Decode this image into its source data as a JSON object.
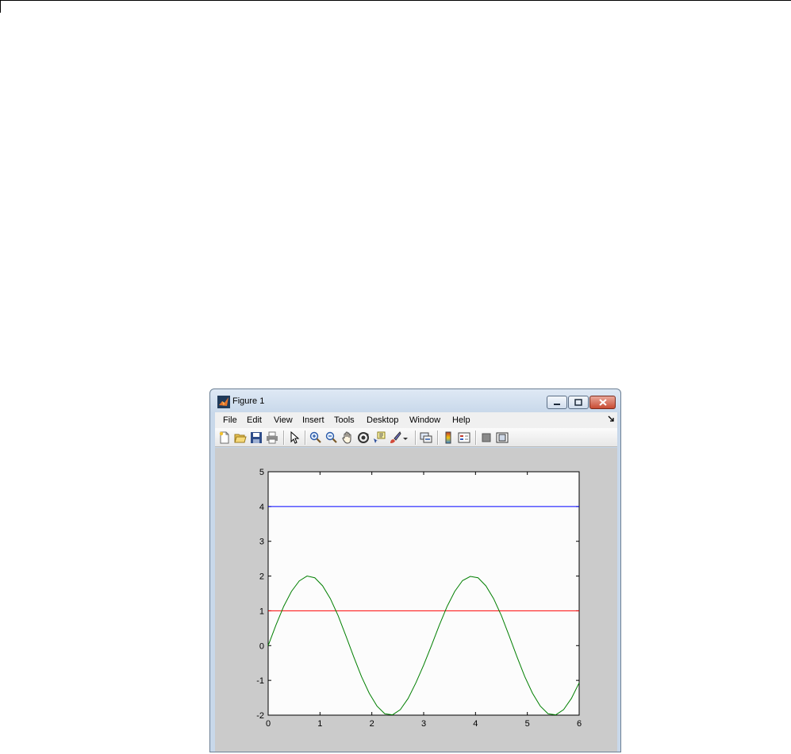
{
  "window": {
    "title": "Figure 1"
  },
  "menubar": {
    "items": [
      "File",
      "Edit",
      "View",
      "Insert",
      "Tools",
      "Desktop",
      "Window",
      "Help"
    ]
  },
  "toolbar": {
    "icons": [
      "new-figure-icon",
      "open-file-icon",
      "save-figure-icon",
      "print-figure-icon",
      "edit-plot-icon",
      "zoom-in-icon",
      "zoom-out-icon",
      "pan-icon",
      "rotate-3d-icon",
      "data-cursor-icon",
      "brush-icon",
      "brush-dropdown-icon",
      "link-plot-icon",
      "insert-colorbar-icon",
      "insert-legend-icon",
      "hide-plot-tools-icon",
      "show-plot-tools-icon"
    ]
  },
  "chart_data": {
    "type": "line",
    "title": "",
    "xlabel": "",
    "ylabel": "",
    "xlim": [
      0,
      6
    ],
    "ylim": [
      -2,
      5
    ],
    "xticks": [
      "0",
      "1",
      "2",
      "3",
      "4",
      "5",
      "6"
    ],
    "yticks": [
      "-2",
      "-1",
      "0",
      "1",
      "2",
      "3",
      "4",
      "5"
    ],
    "grid": false,
    "series": [
      {
        "color": "#0000ff",
        "x": [
          0,
          6
        ],
        "y": [
          4,
          4
        ]
      },
      {
        "color": "#ff0000",
        "x": [
          0,
          6
        ],
        "y": [
          1,
          1
        ]
      },
      {
        "color": "#007f00",
        "x": [
          0,
          0.15,
          0.3,
          0.45,
          0.6,
          0.75,
          0.9,
          1.05,
          1.2,
          1.35,
          1.5,
          1.65,
          1.8,
          1.95,
          2.1,
          2.25,
          2.4,
          2.55,
          2.7,
          2.85,
          3.0,
          3.15,
          3.3,
          3.45,
          3.6,
          3.75,
          3.9,
          4.05,
          4.2,
          4.35,
          4.5,
          4.65,
          4.8,
          4.95,
          5.1,
          5.25,
          5.4,
          5.55,
          5.7,
          5.85,
          6.0
        ],
        "y": [
          0,
          0.59,
          1.13,
          1.56,
          1.86,
          2.0,
          1.95,
          1.72,
          1.35,
          0.86,
          0.28,
          -0.32,
          -0.89,
          -1.37,
          -1.74,
          -1.96,
          -1.99,
          -1.84,
          -1.52,
          -1.07,
          -0.56,
          0.0,
          0.58,
          1.12,
          1.56,
          1.87,
          1.99,
          1.95,
          1.72,
          1.35,
          0.86,
          0.28,
          -0.32,
          -0.89,
          -1.37,
          -1.74,
          -1.96,
          -1.99,
          -1.84,
          -1.52,
          -1.07
        ]
      }
    ]
  }
}
